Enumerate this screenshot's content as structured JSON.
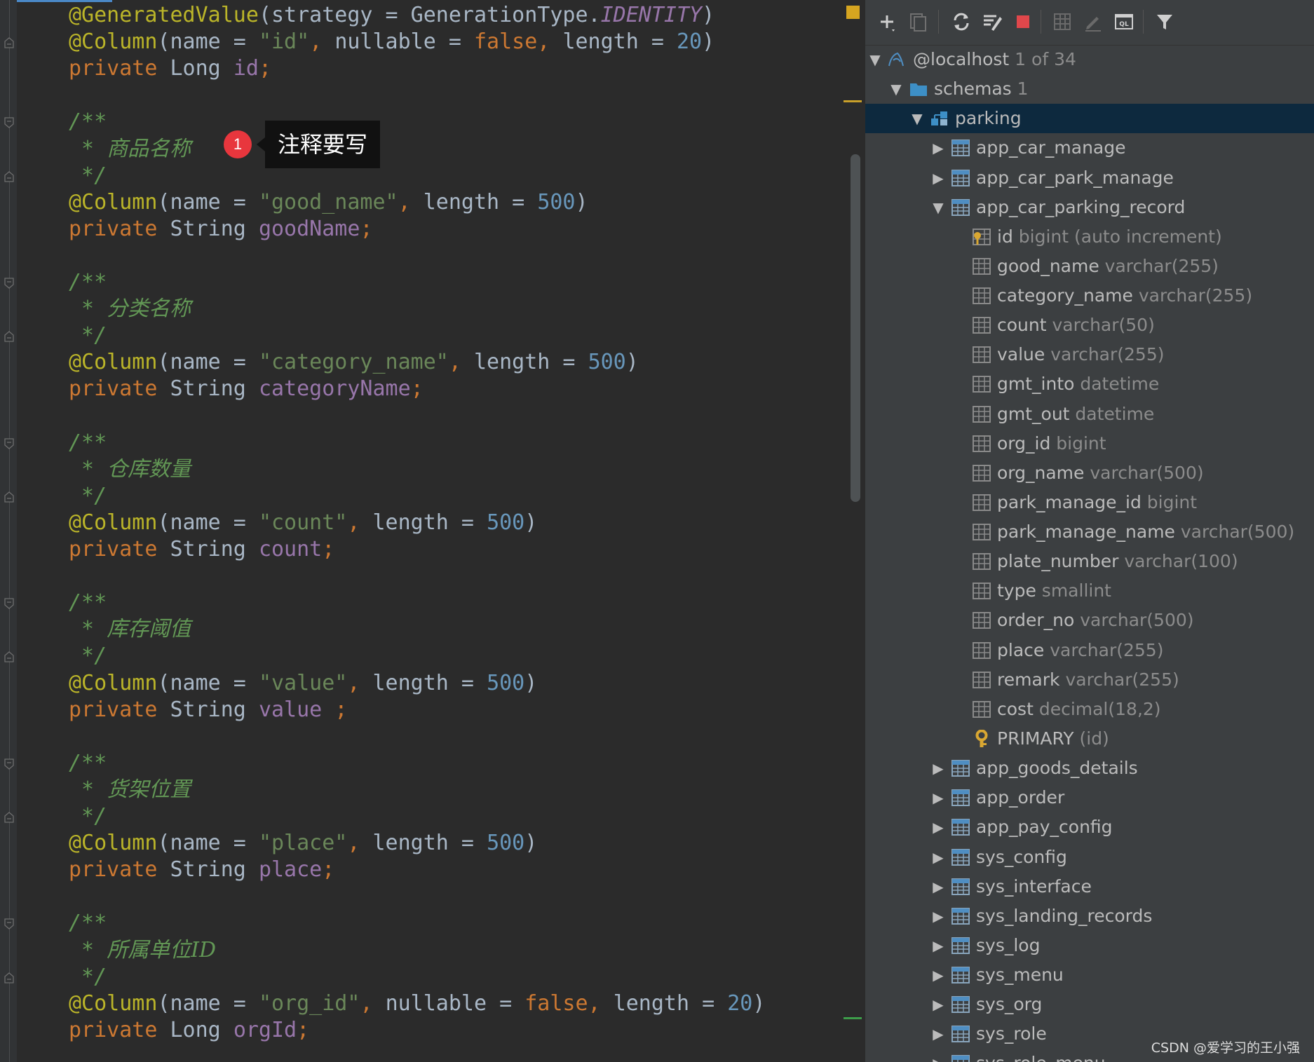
{
  "editor": {
    "lines": [
      {
        "y": 0,
        "parts": [
          [
            "ann",
            "@GeneratedValue"
          ],
          [
            "",
            "(strategy = GenerationType."
          ],
          [
            "ital",
            "IDENTITY"
          ],
          [
            "",
            ")"
          ]
        ]
      },
      {
        "y": 1,
        "parts": [
          [
            "ann",
            "@Column"
          ],
          [
            "",
            "(name = "
          ],
          [
            "str",
            "\"id\""
          ],
          [
            "kw",
            ", "
          ],
          [
            "",
            "nullable = "
          ],
          [
            "kw",
            "false, "
          ],
          [
            "",
            "length = "
          ],
          [
            "num",
            "20"
          ],
          [
            "",
            ")"
          ]
        ]
      },
      {
        "y": 2,
        "parts": [
          [
            "kw",
            "private "
          ],
          [
            "",
            "Long "
          ],
          [
            "fld",
            "id"
          ],
          [
            "kw",
            ";"
          ]
        ]
      },
      {
        "y": 4,
        "parts": [
          [
            "cmt",
            "/**"
          ]
        ]
      },
      {
        "y": 5,
        "parts": [
          [
            "cmt",
            " * "
          ],
          [
            "cmt-cn",
            "商品名称"
          ]
        ]
      },
      {
        "y": 6,
        "parts": [
          [
            "cmt",
            " */"
          ]
        ]
      },
      {
        "y": 7,
        "parts": [
          [
            "ann",
            "@Column"
          ],
          [
            "",
            "(name = "
          ],
          [
            "str",
            "\"good_name\""
          ],
          [
            "kw",
            ", "
          ],
          [
            "",
            "length = "
          ],
          [
            "num",
            "500"
          ],
          [
            "",
            ")"
          ]
        ]
      },
      {
        "y": 8,
        "parts": [
          [
            "kw",
            "private "
          ],
          [
            "",
            "String "
          ],
          [
            "fld",
            "goodName"
          ],
          [
            "kw",
            ";"
          ]
        ]
      },
      {
        "y": 10,
        "parts": [
          [
            "cmt",
            "/**"
          ]
        ]
      },
      {
        "y": 11,
        "parts": [
          [
            "cmt",
            " * "
          ],
          [
            "cmt-cn",
            "分类名称"
          ]
        ]
      },
      {
        "y": 12,
        "parts": [
          [
            "cmt",
            " */"
          ]
        ]
      },
      {
        "y": 13,
        "parts": [
          [
            "ann",
            "@Column"
          ],
          [
            "",
            "(name = "
          ],
          [
            "str",
            "\"category_name\""
          ],
          [
            "kw",
            ", "
          ],
          [
            "",
            "length = "
          ],
          [
            "num",
            "500"
          ],
          [
            "",
            ")"
          ]
        ]
      },
      {
        "y": 14,
        "parts": [
          [
            "kw",
            "private "
          ],
          [
            "",
            "String "
          ],
          [
            "fld",
            "categoryName"
          ],
          [
            "kw",
            ";"
          ]
        ]
      },
      {
        "y": 16,
        "parts": [
          [
            "cmt",
            "/**"
          ]
        ]
      },
      {
        "y": 17,
        "parts": [
          [
            "cmt",
            " * "
          ],
          [
            "cmt-cn",
            "仓库数量"
          ]
        ]
      },
      {
        "y": 18,
        "parts": [
          [
            "cmt",
            " */"
          ]
        ]
      },
      {
        "y": 19,
        "parts": [
          [
            "ann",
            "@Column"
          ],
          [
            "",
            "(name = "
          ],
          [
            "str",
            "\"count\""
          ],
          [
            "kw",
            ", "
          ],
          [
            "",
            "length = "
          ],
          [
            "num",
            "500"
          ],
          [
            "",
            ")"
          ]
        ]
      },
      {
        "y": 20,
        "parts": [
          [
            "kw",
            "private "
          ],
          [
            "",
            "String "
          ],
          [
            "fld",
            "count"
          ],
          [
            "kw",
            ";"
          ]
        ]
      },
      {
        "y": 22,
        "parts": [
          [
            "cmt",
            "/**"
          ]
        ]
      },
      {
        "y": 23,
        "parts": [
          [
            "cmt",
            " * "
          ],
          [
            "cmt-cn",
            "库存阈值"
          ]
        ]
      },
      {
        "y": 24,
        "parts": [
          [
            "cmt",
            " */"
          ]
        ]
      },
      {
        "y": 25,
        "parts": [
          [
            "ann",
            "@Column"
          ],
          [
            "",
            "(name = "
          ],
          [
            "str",
            "\"value\""
          ],
          [
            "kw",
            ", "
          ],
          [
            "",
            "length = "
          ],
          [
            "num",
            "500"
          ],
          [
            "",
            ")"
          ]
        ]
      },
      {
        "y": 26,
        "parts": [
          [
            "kw",
            "private "
          ],
          [
            "",
            "String "
          ],
          [
            "fld",
            "value "
          ],
          [
            "kw",
            ";"
          ]
        ]
      },
      {
        "y": 28,
        "parts": [
          [
            "cmt",
            "/**"
          ]
        ]
      },
      {
        "y": 29,
        "parts": [
          [
            "cmt",
            " * "
          ],
          [
            "cmt-cn",
            "货架位置"
          ]
        ]
      },
      {
        "y": 30,
        "parts": [
          [
            "cmt",
            " */"
          ]
        ]
      },
      {
        "y": 31,
        "parts": [
          [
            "ann",
            "@Column"
          ],
          [
            "",
            "(name = "
          ],
          [
            "str",
            "\"place\""
          ],
          [
            "kw",
            ", "
          ],
          [
            "",
            "length = "
          ],
          [
            "num",
            "500"
          ],
          [
            "",
            ")"
          ]
        ]
      },
      {
        "y": 32,
        "parts": [
          [
            "kw",
            "private "
          ],
          [
            "",
            "String "
          ],
          [
            "fld",
            "place"
          ],
          [
            "kw",
            ";"
          ]
        ]
      },
      {
        "y": 34,
        "parts": [
          [
            "cmt",
            "/**"
          ]
        ]
      },
      {
        "y": 35,
        "parts": [
          [
            "cmt",
            " * "
          ],
          [
            "cmt-cn",
            "所属单位ID"
          ]
        ]
      },
      {
        "y": 36,
        "parts": [
          [
            "cmt",
            " */"
          ]
        ]
      },
      {
        "y": 37,
        "parts": [
          [
            "ann",
            "@Column"
          ],
          [
            "",
            "(name = "
          ],
          [
            "str",
            "\"org_id\""
          ],
          [
            "kw",
            ", "
          ],
          [
            "",
            "nullable = "
          ],
          [
            "kw",
            "false, "
          ],
          [
            "",
            "length = "
          ],
          [
            "num",
            "20"
          ],
          [
            "",
            ")"
          ]
        ]
      },
      {
        "y": 38,
        "parts": [
          [
            "kw",
            "private "
          ],
          [
            "",
            "Long "
          ],
          [
            "fld",
            "orgId"
          ],
          [
            "kw",
            ";"
          ]
        ]
      }
    ],
    "callout_badge": "1",
    "callout_text": "注释要写"
  },
  "db": {
    "toolbar_icons": [
      "add-icon",
      "duplicate-icon",
      "refresh-icon",
      "sync-icon",
      "stop-icon",
      "table-view-icon",
      "edit-icon",
      "console-icon",
      "filter-icon"
    ],
    "tree": [
      {
        "level": 0,
        "arrow": "open",
        "icon": "datasource-icon",
        "label": "@localhost",
        "type": "1 of 34"
      },
      {
        "level": 1,
        "arrow": "open",
        "icon": "folder-icon",
        "label": "schemas",
        "type": "1"
      },
      {
        "level": 2,
        "arrow": "open",
        "icon": "schema-icon",
        "label": "parking",
        "type": "",
        "selected": true
      },
      {
        "level": 3,
        "arrow": "closed",
        "icon": "table-icon",
        "label": "app_car_manage",
        "type": ""
      },
      {
        "level": 3,
        "arrow": "closed",
        "icon": "table-icon",
        "label": "app_car_park_manage",
        "type": ""
      },
      {
        "level": 3,
        "arrow": "open",
        "icon": "table-icon",
        "label": "app_car_parking_record",
        "type": ""
      },
      {
        "level": 4,
        "arrow": "",
        "icon": "pk-column-icon",
        "label": "id",
        "type": "bigint (auto increment)"
      },
      {
        "level": 4,
        "arrow": "",
        "icon": "column-icon",
        "label": "good_name",
        "type": "varchar(255)"
      },
      {
        "level": 4,
        "arrow": "",
        "icon": "column-icon",
        "label": "category_name",
        "type": "varchar(255)"
      },
      {
        "level": 4,
        "arrow": "",
        "icon": "column-icon",
        "label": "count",
        "type": "varchar(50)"
      },
      {
        "level": 4,
        "arrow": "",
        "icon": "column-icon",
        "label": "value",
        "type": "varchar(255)"
      },
      {
        "level": 4,
        "arrow": "",
        "icon": "column-icon",
        "label": "gmt_into",
        "type": "datetime"
      },
      {
        "level": 4,
        "arrow": "",
        "icon": "column-icon",
        "label": "gmt_out",
        "type": "datetime"
      },
      {
        "level": 4,
        "arrow": "",
        "icon": "column-icon",
        "label": "org_id",
        "type": "bigint"
      },
      {
        "level": 4,
        "arrow": "",
        "icon": "column-icon",
        "label": "org_name",
        "type": "varchar(500)"
      },
      {
        "level": 4,
        "arrow": "",
        "icon": "column-icon",
        "label": "park_manage_id",
        "type": "bigint"
      },
      {
        "level": 4,
        "arrow": "",
        "icon": "column-icon",
        "label": "park_manage_name",
        "type": "varchar(500)"
      },
      {
        "level": 4,
        "arrow": "",
        "icon": "column-icon",
        "label": "plate_number",
        "type": "varchar(100)"
      },
      {
        "level": 4,
        "arrow": "",
        "icon": "column-icon",
        "label": "type",
        "type": "smallint"
      },
      {
        "level": 4,
        "arrow": "",
        "icon": "column-icon",
        "label": "order_no",
        "type": "varchar(500)"
      },
      {
        "level": 4,
        "arrow": "",
        "icon": "column-icon",
        "label": "place",
        "type": "varchar(255)"
      },
      {
        "level": 4,
        "arrow": "",
        "icon": "column-icon",
        "label": "remark",
        "type": "varchar(255)"
      },
      {
        "level": 4,
        "arrow": "",
        "icon": "column-icon",
        "label": "cost",
        "type": "decimal(18,2)"
      },
      {
        "level": 4,
        "arrow": "",
        "icon": "key-icon",
        "label": "PRIMARY",
        "type": "(id)"
      },
      {
        "level": 3,
        "arrow": "closed",
        "icon": "table-icon",
        "label": "app_goods_details",
        "type": ""
      },
      {
        "level": 3,
        "arrow": "closed",
        "icon": "table-icon",
        "label": "app_order",
        "type": ""
      },
      {
        "level": 3,
        "arrow": "closed",
        "icon": "table-icon",
        "label": "app_pay_config",
        "type": ""
      },
      {
        "level": 3,
        "arrow": "closed",
        "icon": "table-icon",
        "label": "sys_config",
        "type": ""
      },
      {
        "level": 3,
        "arrow": "closed",
        "icon": "table-icon",
        "label": "sys_interface",
        "type": ""
      },
      {
        "level": 3,
        "arrow": "closed",
        "icon": "table-icon",
        "label": "sys_landing_records",
        "type": ""
      },
      {
        "level": 3,
        "arrow": "closed",
        "icon": "table-icon",
        "label": "sys_log",
        "type": ""
      },
      {
        "level": 3,
        "arrow": "closed",
        "icon": "table-icon",
        "label": "sys_menu",
        "type": ""
      },
      {
        "level": 3,
        "arrow": "closed",
        "icon": "table-icon",
        "label": "sys_org",
        "type": ""
      },
      {
        "level": 3,
        "arrow": "closed",
        "icon": "table-icon",
        "label": "sys_role",
        "type": ""
      },
      {
        "level": 3,
        "arrow": "closed",
        "icon": "table-icon",
        "label": "sys_role_menu",
        "type": ""
      }
    ]
  },
  "watermark": "CSDN @爱学习的王小强"
}
